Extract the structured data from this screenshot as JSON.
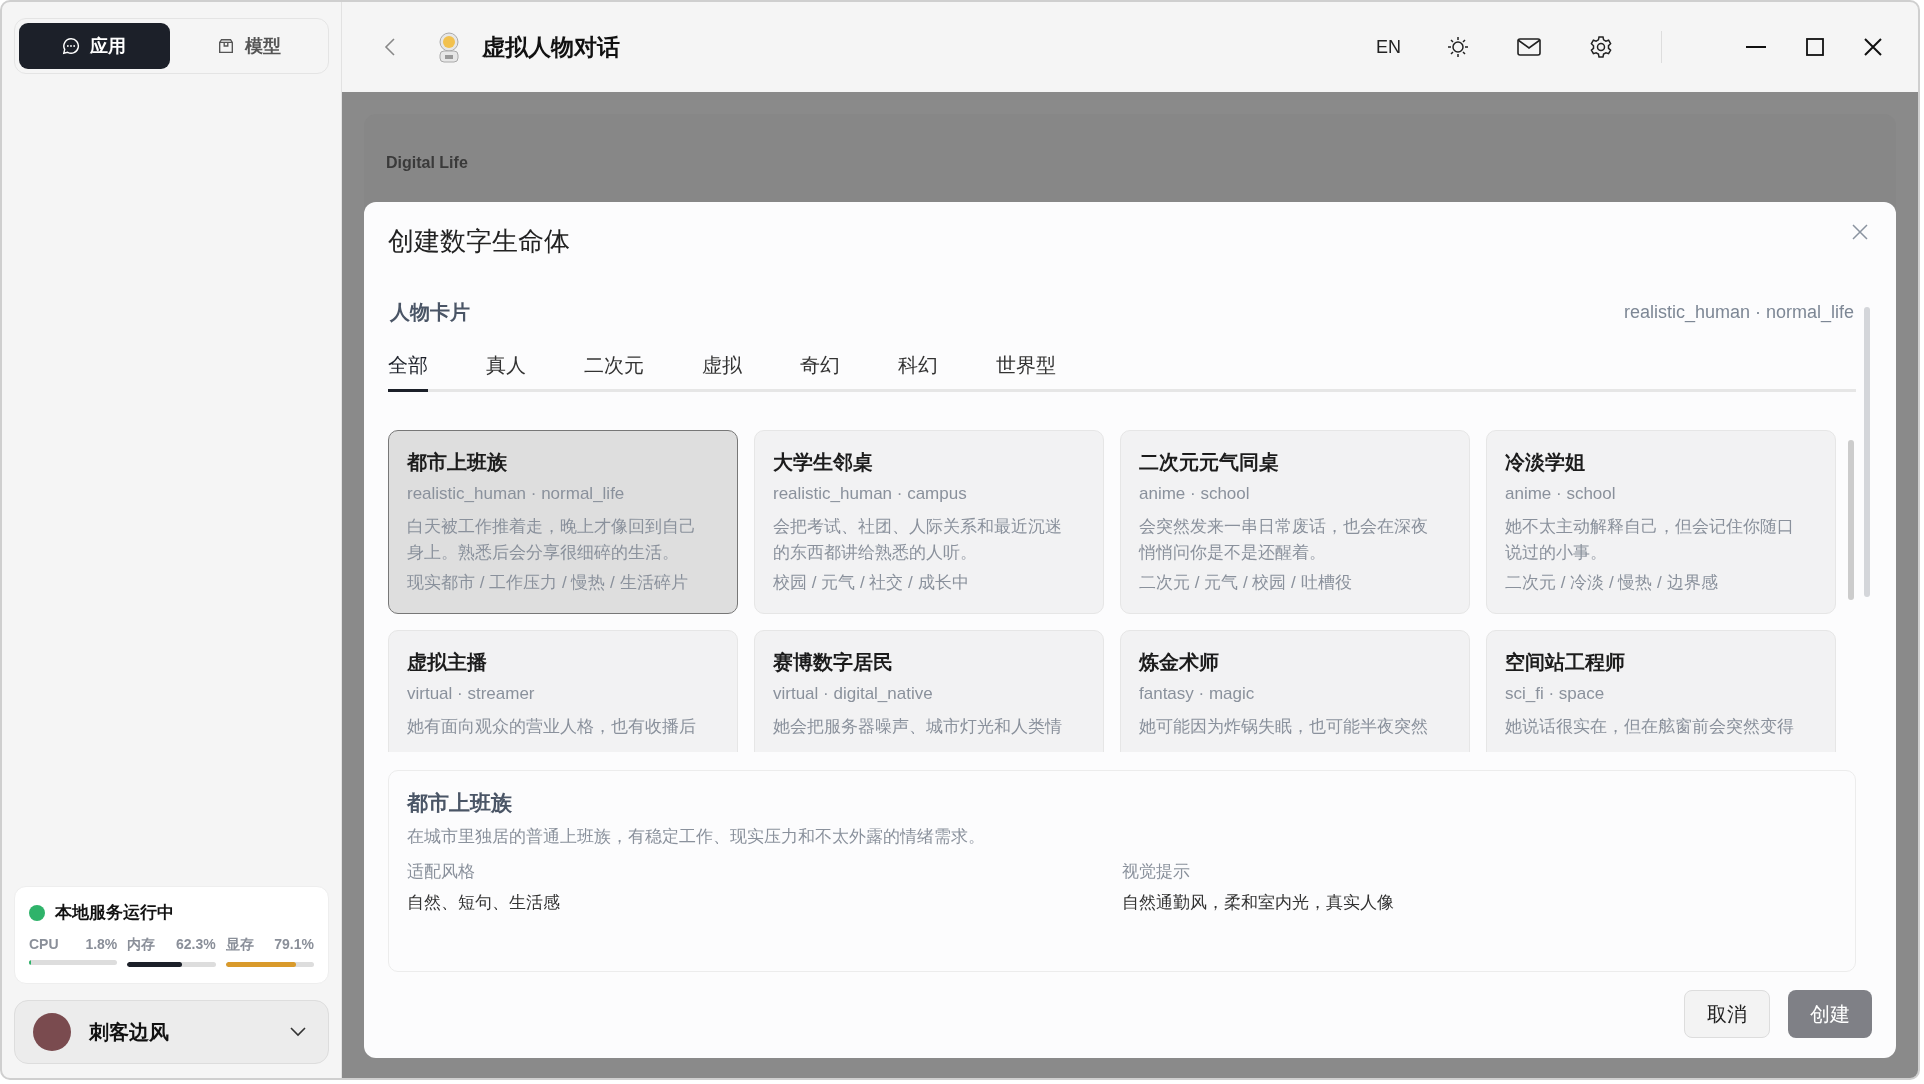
{
  "sidebar": {
    "tabs": [
      {
        "label": "应用",
        "selected": true,
        "kind": "chat"
      },
      {
        "label": "模型",
        "selected": false,
        "kind": "box"
      }
    ],
    "status": {
      "title": "本地服务运行中",
      "online": true,
      "metrics": [
        {
          "label": "CPU",
          "reading": "1.8%",
          "level": 0.018,
          "color": "#2fb36a"
        },
        {
          "label": "内存",
          "reading": "62.3%",
          "level": 0.623,
          "color": "#1c2029"
        },
        {
          "label": "显存",
          "reading": "79.1%",
          "level": 0.791,
          "color": "#d99a2b"
        }
      ]
    },
    "user": {
      "name": "刺客边风"
    }
  },
  "header": {
    "title": "虚拟人物对话",
    "lang": "EN"
  },
  "background": {
    "eyebrow": "Digital Life"
  },
  "dialog": {
    "title": "创建数字生命体",
    "section": "人物卡片",
    "selected_meta": "realistic_human · normal_life",
    "tabs": [
      {
        "label": "全部",
        "selected": true
      },
      {
        "label": "真人",
        "selected": false
      },
      {
        "label": "二次元",
        "selected": false
      },
      {
        "label": "虚拟",
        "selected": false
      },
      {
        "label": "奇幻",
        "selected": false
      },
      {
        "label": "科幻",
        "selected": false
      },
      {
        "label": "世界型",
        "selected": false
      }
    ],
    "cards": [
      {
        "name": "都市上班族",
        "meta": "realistic_human · normal_life",
        "desc": "白天被工作推着走，晚上才像回到自己身上。熟悉后会分享很细碎的生活。",
        "tags": "现实都市 / 工作压力 / 慢热 / 生活碎片",
        "selected": true
      },
      {
        "name": "大学生邻桌",
        "meta": "realistic_human · campus",
        "desc": "会把考试、社团、人际关系和最近沉迷的东西都讲给熟悉的人听。",
        "tags": "校园 / 元气 / 社交 / 成长中",
        "selected": false
      },
      {
        "name": "二次元元气同桌",
        "meta": "anime · school",
        "desc": "会突然发来一串日常废话，也会在深夜悄悄问你是不是还醒着。",
        "tags": "二次元 / 元气 / 校园 / 吐槽役",
        "selected": false
      },
      {
        "name": "冷淡学姐",
        "meta": "anime · school",
        "desc": "她不太主动解释自己，但会记住你随口说过的小事。",
        "tags": "二次元 / 冷淡 / 慢热 / 边界感",
        "selected": false
      },
      {
        "name": "虚拟主播",
        "meta": "virtual · streamer",
        "desc": "她有面向观众的营业人格，也有收播后",
        "selected": false
      },
      {
        "name": "赛博数字居民",
        "meta": "virtual · digital_native",
        "desc": "她会把服务器噪声、城市灯光和人类情",
        "selected": false
      },
      {
        "name": "炼金术师",
        "meta": "fantasy · magic",
        "desc": "她可能因为炸锅失眠，也可能半夜突然",
        "selected": false
      },
      {
        "name": "空间站工程师",
        "meta": "sci_fi · space",
        "desc": "她说话很实在，但在舷窗前会突然变得",
        "selected": false
      }
    ],
    "detail": {
      "name": "都市上班族",
      "summary": "在城市里独居的普通上班族，有稳定工作、现实压力和不太外露的情绪需求。",
      "fields": [
        {
          "label": "适配风格",
          "value": "自然、短句、生活感"
        },
        {
          "label": "视觉提示",
          "value": "自然通勤风，柔和室内光，真实人像"
        }
      ]
    },
    "buttons": [
      {
        "label": "取消",
        "kind": "secondary"
      },
      {
        "label": "创建",
        "kind": "primary"
      }
    ]
  }
}
